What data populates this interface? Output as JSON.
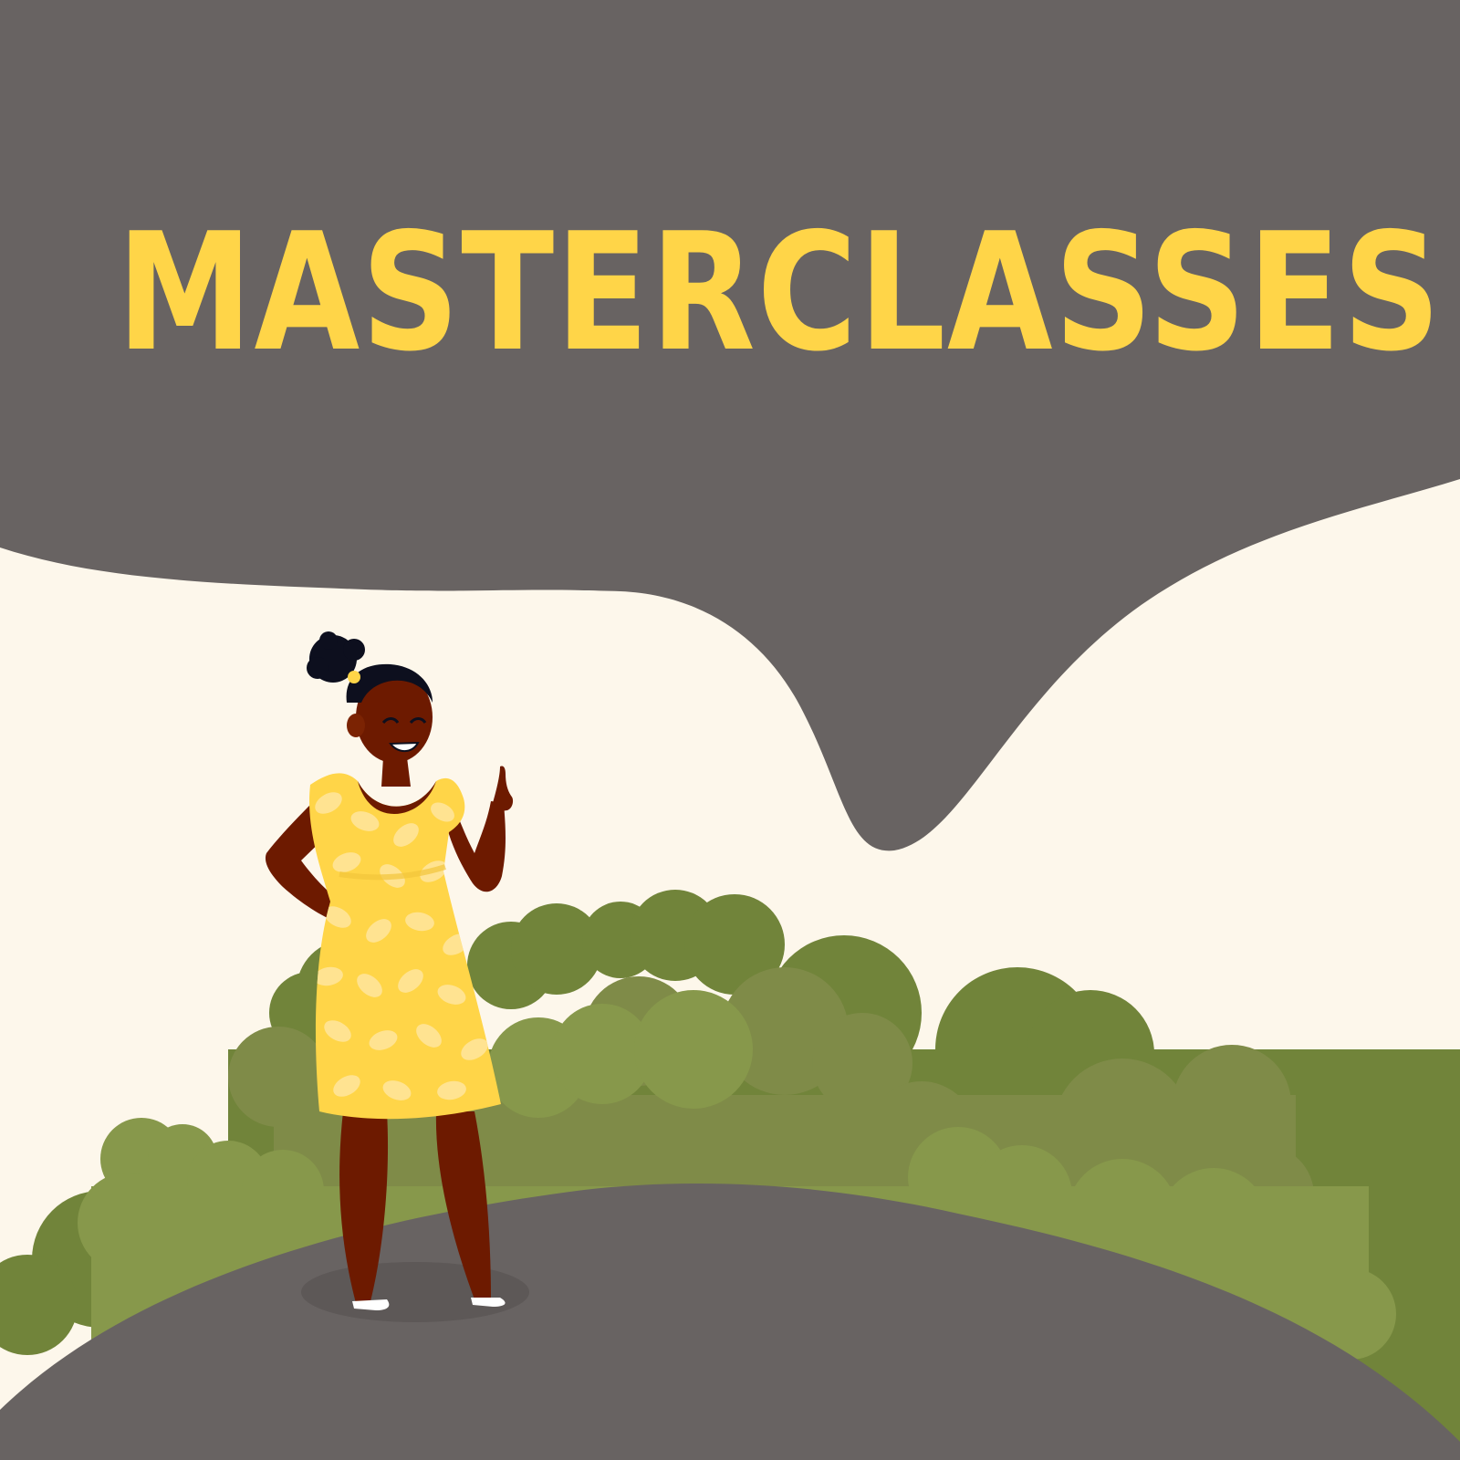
{
  "title": "MASTERCLASSES",
  "colors": {
    "background": "#fdf7eb",
    "band": "#686362",
    "title": "#ffd548",
    "bush_dark": "#71843a",
    "bush_mid": "#7f8b48",
    "bush_light": "#87984b",
    "path": "#686362",
    "skin": "#6d1a00",
    "dress": "#ffd548",
    "hair": "#0d0f1e"
  },
  "illustration": {
    "character": "woman-thumbs-up",
    "scenery": [
      "grey-band",
      "bushes",
      "grey-hill-path"
    ]
  }
}
